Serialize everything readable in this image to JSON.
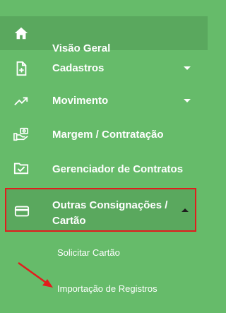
{
  "menu": {
    "items": [
      {
        "label": "Visão Geral",
        "icon": "home-icon"
      },
      {
        "label": "Cadastros",
        "icon": "document-add-icon",
        "expand": "collapsed"
      },
      {
        "label": "Movimento",
        "icon": "trending-up-icon",
        "expand": "collapsed"
      },
      {
        "label": "Margem / Contratação",
        "icon": "money-hand-icon"
      },
      {
        "label": "Gerenciador de Contratos",
        "icon": "folder-check-icon"
      },
      {
        "label_line1": "Outras Consignações /",
        "label_line2": "Cartão",
        "icon": "credit-card-icon",
        "expand": "expanded",
        "highlighted": true
      }
    ],
    "subitems": [
      {
        "label": "Solicitar Cartão"
      },
      {
        "label": "Importação de Registros"
      }
    ]
  },
  "colors": {
    "sidebar_bg": "#66bb6a",
    "active_bg": "#5aa85e",
    "highlight_border": "#e11d1d",
    "annotation_arrow": "#e11d1d"
  }
}
